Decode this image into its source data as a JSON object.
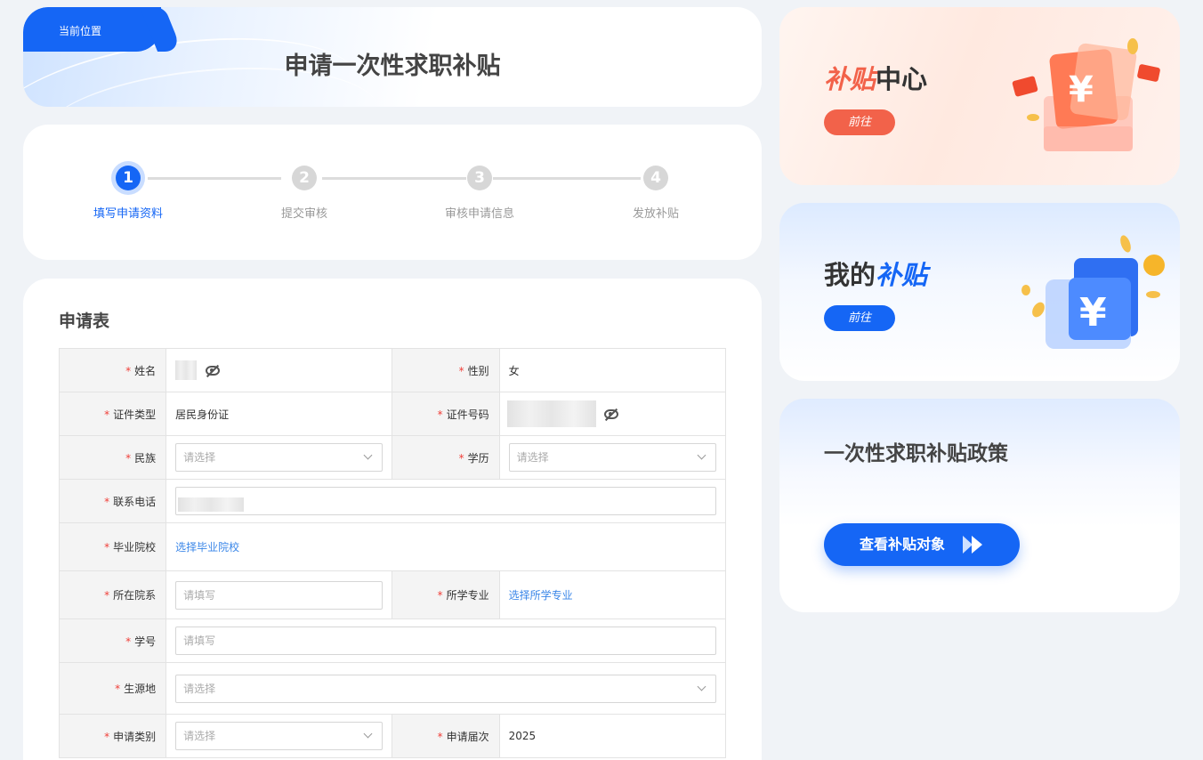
{
  "header": {
    "location_label": "当前位置",
    "page_title": "申请一次性求职补贴"
  },
  "steps": [
    {
      "num": "1",
      "label": "填写申请资料",
      "active": true
    },
    {
      "num": "2",
      "label": "提交审核",
      "active": false
    },
    {
      "num": "3",
      "label": "审核申请信息",
      "active": false
    },
    {
      "num": "4",
      "label": "发放补贴",
      "active": false
    }
  ],
  "form": {
    "title": "申请表",
    "required_mark": "*",
    "name_label": "姓名",
    "gender_label": "性别",
    "gender_value": "女",
    "id_type_label": "证件类型",
    "id_type_value": "居民身份证",
    "id_number_label": "证件号码",
    "ethnicity_label": "民族",
    "ethnicity_placeholder": "请选择",
    "education_label": "学历",
    "education_placeholder": "请选择",
    "phone_label": "联系电话",
    "school_label": "毕业院校",
    "school_link": "选择毕业院校",
    "department_label": "所在院系",
    "department_placeholder": "请填写",
    "major_label": "所学专业",
    "major_link": "选择所学专业",
    "student_id_label": "学号",
    "student_id_placeholder": "请填写",
    "origin_label": "生源地",
    "origin_placeholder": "请选择",
    "apply_type_label": "申请类别",
    "apply_type_placeholder": "请选择",
    "session_label": "申请届次",
    "session_value": "2025"
  },
  "subsidy_center": {
    "title_em": "补贴",
    "title_rest": "中心",
    "button": "前往"
  },
  "my_subsidy": {
    "title_rest": "我的",
    "title_em": "补贴",
    "button": "前往"
  },
  "policy": {
    "title": "一次性求职补贴政策",
    "button": "查看补贴对象"
  },
  "colors": {
    "primary": "#1566f5",
    "orange": "#f2624a",
    "required": "#f0403a",
    "link": "#3a86e8"
  }
}
